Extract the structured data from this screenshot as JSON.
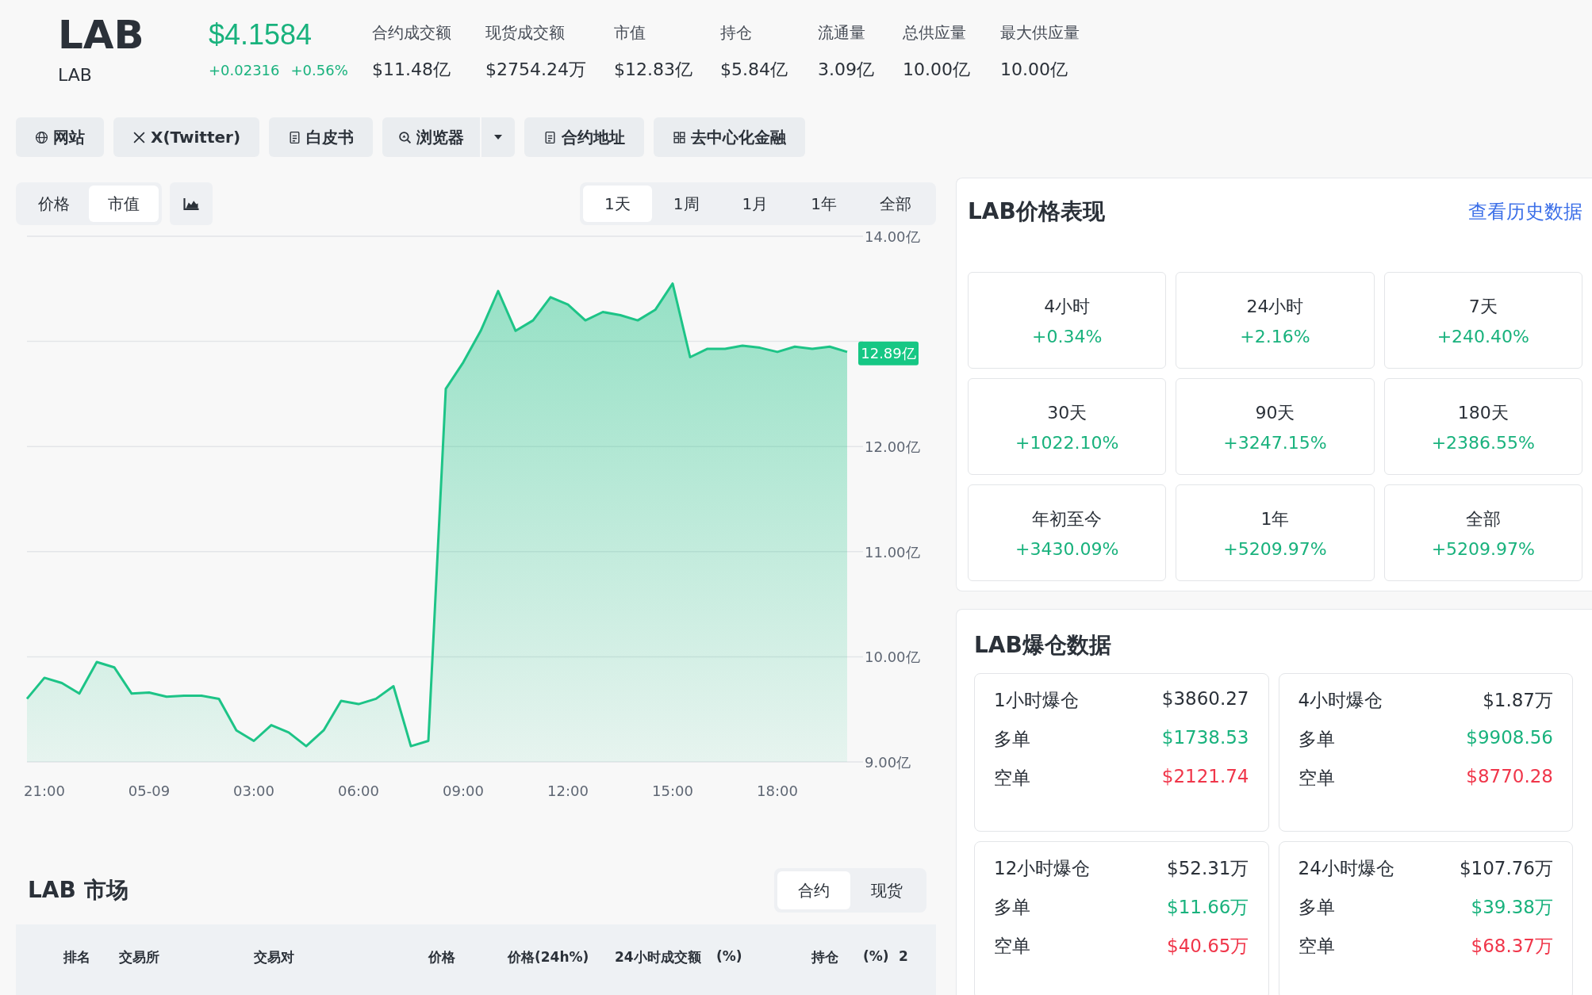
{
  "coin": {
    "name": "LAB",
    "symbol": "LAB",
    "price": "$4.1584",
    "change_abs": "+0.02316",
    "change_pct": "+0.56%"
  },
  "stats": [
    {
      "label": "合约成交额",
      "value": "$11.48亿"
    },
    {
      "label": "现货成交额",
      "value": "$2754.24万"
    },
    {
      "label": "市值",
      "value": "$12.83亿"
    },
    {
      "label": "持仓",
      "value": "$5.84亿"
    },
    {
      "label": "流通量",
      "value": "3.09亿"
    },
    {
      "label": "总供应量",
      "value": "10.00亿"
    },
    {
      "label": "最大供应量",
      "value": "10.00亿"
    }
  ],
  "links": [
    {
      "label": "网站",
      "dropdown": false
    },
    {
      "label": "X(Twitter)",
      "dropdown": false
    },
    {
      "label": "白皮书",
      "dropdown": false
    },
    {
      "label": "浏览器",
      "dropdown": true
    },
    {
      "label": "合约地址",
      "dropdown": false
    },
    {
      "label": "去中心化金融",
      "dropdown": false
    }
  ],
  "chart_tabs": [
    {
      "label": "价格",
      "selected": false
    },
    {
      "label": "市值",
      "selected": true
    }
  ],
  "periods": [
    {
      "label": "1天",
      "selected": true
    },
    {
      "label": "1周",
      "selected": false
    },
    {
      "label": "1月",
      "selected": false
    },
    {
      "label": "1年",
      "selected": false
    },
    {
      "label": "全部",
      "selected": false
    }
  ],
  "chart": {
    "current_value": "12.89亿",
    "chart_data": {
      "type": "area",
      "grid": true,
      "categories": [
        null,
        "21:00",
        null,
        null,
        null,
        null,
        null,
        "05-09",
        null,
        null,
        null,
        null,
        null,
        "03:00",
        null,
        null,
        null,
        null,
        null,
        "06:00",
        null,
        null,
        null,
        null,
        null,
        "09:00",
        null,
        null,
        null,
        null,
        null,
        "12:00",
        null,
        null,
        null,
        null,
        null,
        "15:00",
        null,
        null,
        null,
        null,
        null,
        "18:00",
        null,
        null,
        null,
        null
      ],
      "series": [
        {
          "color": "#1dc487",
          "values": [
            9.6,
            9.8,
            9.75,
            9.65,
            9.95,
            9.9,
            9.65,
            9.66,
            9.62,
            9.63,
            9.63,
            9.6,
            9.3,
            9.2,
            9.35,
            9.28,
            9.15,
            9.3,
            9.58,
            9.55,
            9.6,
            9.72,
            9.15,
            9.2,
            12.55,
            12.8,
            13.1,
            13.48,
            13.1,
            13.2,
            13.42,
            13.35,
            13.2,
            13.28,
            13.25,
            13.2,
            13.3,
            13.55,
            12.85,
            12.93,
            12.93,
            12.96,
            12.94,
            12.9,
            12.95,
            12.93,
            12.95,
            12.9
          ]
        }
      ],
      "yticks": [
        {
          "value": 9,
          "label": "9.00亿"
        },
        {
          "value": 10,
          "label": "10.00亿"
        },
        {
          "value": 11,
          "label": "11.00亿"
        },
        {
          "value": 12,
          "label": "12.00亿"
        },
        {
          "value": 14,
          "label": "14.00亿"
        }
      ],
      "ylim": [
        9,
        14
      ]
    }
  },
  "market": {
    "title": "LAB 市场",
    "tabs": [
      {
        "label": "合约",
        "selected": true
      },
      {
        "label": "现货",
        "selected": false
      }
    ],
    "columns": [
      "排名",
      "交易所",
      "交易对",
      "价格",
      "价格(24h%)",
      "24小时成交额",
      "(%)",
      "持仓",
      "(%)",
      "2"
    ]
  },
  "performance": {
    "title": "LAB价格表现",
    "link": "查看历史数据",
    "items": [
      {
        "label": "4小时",
        "value": "+0.34%"
      },
      {
        "label": "24小时",
        "value": "+2.16%"
      },
      {
        "label": "7天",
        "value": "+240.40%"
      },
      {
        "label": "30天",
        "value": "+1022.10%"
      },
      {
        "label": "90天",
        "value": "+3247.15%"
      },
      {
        "label": "180天",
        "value": "+2386.55%"
      },
      {
        "label": "年初至今",
        "value": "+3430.09%"
      },
      {
        "label": "1年",
        "value": "+5209.97%"
      },
      {
        "label": "全部",
        "value": "+5209.97%"
      }
    ]
  },
  "liquidations": {
    "title": "LAB爆仓数据",
    "cards": [
      {
        "rows": [
          {
            "kind": "total",
            "label": "1小时爆仓",
            "value": "$3860.27"
          },
          {
            "kind": "long",
            "label": "多单",
            "value": "$1738.53"
          },
          {
            "kind": "short",
            "label": "空单",
            "value": "$2121.74"
          }
        ]
      },
      {
        "rows": [
          {
            "kind": "total",
            "label": "4小时爆仓",
            "value": "$1.87万"
          },
          {
            "kind": "long",
            "label": "多单",
            "value": "$9908.56"
          },
          {
            "kind": "short",
            "label": "空单",
            "value": "$8770.28"
          }
        ]
      },
      {
        "rows": [
          {
            "kind": "total",
            "label": "12小时爆仓",
            "value": "$52.31万"
          },
          {
            "kind": "long",
            "label": "多单",
            "value": "$11.66万"
          },
          {
            "kind": "short",
            "label": "空单",
            "value": "$40.65万"
          }
        ]
      },
      {
        "rows": [
          {
            "kind": "total",
            "label": "24小时爆仓",
            "value": "$107.76万"
          },
          {
            "kind": "long",
            "label": "多单",
            "value": "$39.38万"
          },
          {
            "kind": "short",
            "label": "空单",
            "value": "$68.37万"
          }
        ]
      }
    ]
  }
}
